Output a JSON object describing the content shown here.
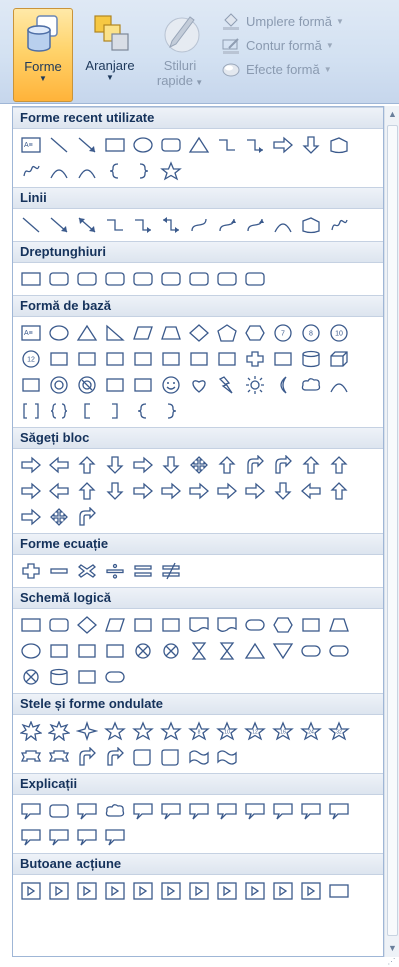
{
  "ribbon": {
    "forme_label": "Forme",
    "aranjare_label": "Aranjare",
    "stiluri_label_line1": "Stiluri",
    "stiluri_label_line2": "rapide",
    "umplere_label": "Umplere formă",
    "contur_label": "Contur formă",
    "efecte_label": "Efecte formă"
  },
  "sections": [
    {
      "title": "Forme recent utilizate",
      "rows": [
        [
          "textbox",
          "line",
          "arrow-line",
          "rect",
          "oval",
          "rounded-rect",
          "triangle",
          "elbow",
          "elbow-arrow",
          "right-arrow",
          "down-arrow",
          "flowchart-document"
        ],
        [
          "freeform",
          "arc",
          "curve",
          "left-brace",
          "right-brace",
          "star5"
        ]
      ]
    },
    {
      "title": "Linii",
      "rows": [
        [
          "line",
          "arrow-line",
          "double-arrow-line",
          "elbow",
          "elbow-arrow",
          "elbow-double-arrow",
          "curve-s",
          "curve-arrow",
          "curve-double-arrow",
          "curve",
          "freeform-shape",
          "scribble"
        ]
      ]
    },
    {
      "title": "Dreptunghiuri",
      "rows": [
        [
          "rect",
          "rounded-rect",
          "snip1-rect",
          "snip2-rect",
          "snip-round-rect",
          "round1-rect",
          "round2-rect",
          "round-diag-rect",
          "rounded-rect"
        ]
      ]
    },
    {
      "title": "Formă de bază",
      "rows": [
        [
          "textbox",
          "oval",
          "triangle",
          "right-triangle",
          "parallelogram",
          "trapezoid",
          "diamond",
          "pentagon",
          "hexagon",
          "circle-7",
          "circle-8",
          "circle-10"
        ],
        [
          "circle-12",
          "pie",
          "chord",
          "teardrop",
          "frame",
          "half-frame",
          "l-shape",
          "diagonal-stripe",
          "cross",
          "plaque",
          "can",
          "cube"
        ],
        [
          "bevel",
          "donut",
          "no-symbol",
          "block-arc",
          "folded-corner",
          "smiley",
          "heart",
          "lightning",
          "sun",
          "moon",
          "cloud",
          "arc"
        ],
        [
          "double-bracket",
          "double-brace",
          "left-bracket",
          "right-bracket",
          "left-brace",
          "right-brace"
        ]
      ]
    },
    {
      "title": "Săgeți bloc",
      "rows": [
        [
          "right-arrow",
          "left-arrow",
          "up-arrow",
          "down-arrow",
          "left-right-arrow",
          "up-down-arrow",
          "quad-arrow",
          "left-right-up-arrow",
          "bent-arrow",
          "u-turn-arrow",
          "left-up-arrow",
          "bent-up-arrow"
        ],
        [
          "curved-right-arrow",
          "curved-left-arrow",
          "curved-up-arrow",
          "curved-down-arrow",
          "striped-right-arrow",
          "notched-right-arrow",
          "pentagon-arrow",
          "chevron",
          "right-arrow-callout",
          "down-arrow-callout",
          "left-arrow-callout",
          "up-arrow-callout"
        ],
        [
          "left-right-arrow-callout",
          "quad-arrow-callout",
          "circular-arrow"
        ]
      ]
    },
    {
      "title": "Forme ecuație",
      "rows": [
        [
          "plus",
          "minus",
          "multiply",
          "divide",
          "equal",
          "not-equal"
        ]
      ]
    },
    {
      "title": "Schemă logică",
      "rows": [
        [
          "fc-process",
          "fc-alt-process",
          "fc-decision",
          "fc-data",
          "fc-predefined",
          "fc-internal-storage",
          "fc-document",
          "fc-multidocument",
          "fc-terminator",
          "fc-preparation",
          "fc-manual-input",
          "fc-manual-operation"
        ],
        [
          "fc-connector",
          "fc-offpage",
          "fc-card",
          "fc-punched-tape",
          "fc-summing",
          "fc-or",
          "fc-collate",
          "fc-sort",
          "fc-extract",
          "fc-merge",
          "fc-stored-data",
          "fc-delay"
        ],
        [
          "fc-sequential",
          "fc-magnetic-disk",
          "fc-direct-access",
          "fc-display"
        ]
      ]
    },
    {
      "title": "Stele și forme ondulate",
      "rows": [
        [
          "explosion1",
          "explosion2",
          "star4",
          "star5",
          "star6",
          "star7",
          "star8",
          "star10",
          "star12",
          "star16",
          "star24",
          "star32"
        ],
        [
          "ribbon-up",
          "ribbon-down",
          "curved-ribbon-up",
          "curved-ribbon-down",
          "vertical-scroll",
          "horizontal-scroll",
          "wave",
          "double-wave"
        ]
      ]
    },
    {
      "title": "Explicații",
      "rows": [
        [
          "rect-callout",
          "rounded-callout",
          "oval-callout",
          "cloud-callout",
          "line-callout1",
          "line-callout2",
          "line-callout3",
          "line-callout1-accent",
          "line-callout2-accent",
          "line-callout3-accent",
          "line-callout1-border",
          "line-callout2-border"
        ],
        [
          "line-callout3-border",
          "line-callout1-noborder",
          "line-callout2-noborder",
          "line-callout3-noborder"
        ]
      ]
    },
    {
      "title": "Butoane acțiune",
      "rows": [
        [
          "action-back",
          "action-forward",
          "action-beginning",
          "action-end",
          "action-home",
          "action-info",
          "action-return",
          "action-movie",
          "action-document",
          "action-sound",
          "action-help",
          "action-blank"
        ]
      ]
    }
  ]
}
